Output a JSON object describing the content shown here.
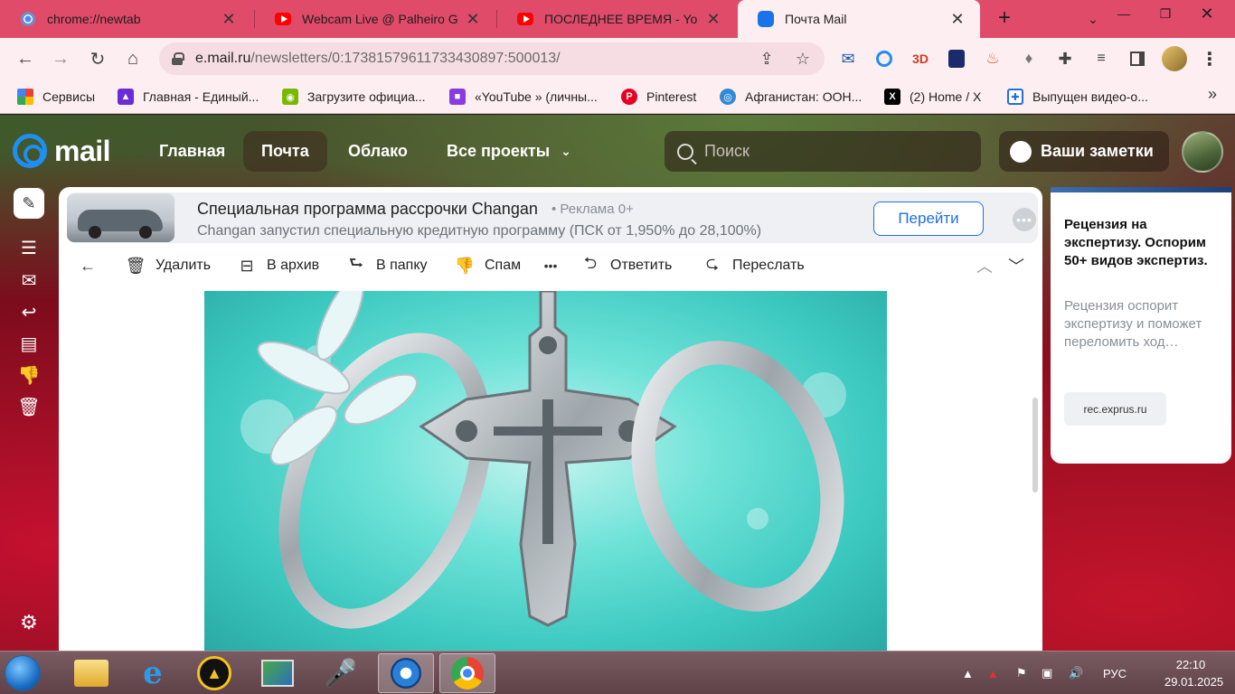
{
  "browser": {
    "tabs": [
      {
        "title": "chrome://newtab",
        "icon": "chrome-icon"
      },
      {
        "title": "Webcam Live @ Palheiro Go",
        "icon": "youtube-icon"
      },
      {
        "title": "ПОСЛЕДНЕЕ ВРЕМЯ - YouTu",
        "icon": "youtube-icon"
      },
      {
        "title": "Почта Mail",
        "icon": "mail-icon",
        "active": true
      }
    ],
    "new_tab": "+",
    "url_host": "e.mail.ru",
    "url_path": "/newsletters/0:17381579611733430897:500013/",
    "bookmarks": [
      {
        "label": "Сервисы",
        "icon": "apps-grid-icon"
      },
      {
        "label": "Главная - Единый...",
        "icon": "bookmark-icon"
      },
      {
        "label": "Загрузите официа...",
        "icon": "nvidia-icon"
      },
      {
        "label": "«YouTube » (личны...",
        "icon": "bookmark-icon"
      },
      {
        "label": "Pinterest",
        "icon": "pinterest-icon"
      },
      {
        "label": "Афганистан: ООН...",
        "icon": "un-icon"
      },
      {
        "label": "(2) Home / X",
        "icon": "x-icon"
      },
      {
        "label": "Выпущен видео-о...",
        "icon": "bookmark-icon"
      }
    ],
    "bookmarks_more": "»",
    "extensions_3d_label": "3D"
  },
  "mail": {
    "logo_text": "mail",
    "nav": [
      "Главная",
      "Почта",
      "Облако",
      "Все проекты"
    ],
    "nav_active": "Почта",
    "search_placeholder": "Поиск",
    "notes_label": "Ваши заметки",
    "ad": {
      "title": "Специальная программа рассрочки Changan",
      "tag": "• Реклама 0+",
      "description": "Changan запустил специальную кредитную программу (ПСК от 1,950% до 28,100%)",
      "cta": "Перейти"
    },
    "actions": {
      "delete": "Удалить",
      "archive": "В архив",
      "to_folder": "В папку",
      "spam": "Спам",
      "reply": "Ответить",
      "forward": "Переслать"
    },
    "promo": {
      "title": "Рецензия на экспертизу. Оспорим 50+ видов экспертиз.",
      "description": "Рецензия оспорит экспертизу и поможет переломить ход…",
      "link": "rec.exprus.ru"
    }
  },
  "taskbar": {
    "language": "РУС",
    "time": "22:10",
    "date": "29.01.2025"
  },
  "colors": {
    "tab_strip": "#e04b6a",
    "toolbar": "#fdeef1",
    "accent_blue": "#1f6fe0",
    "mail_logo": "#1f8ef1"
  }
}
